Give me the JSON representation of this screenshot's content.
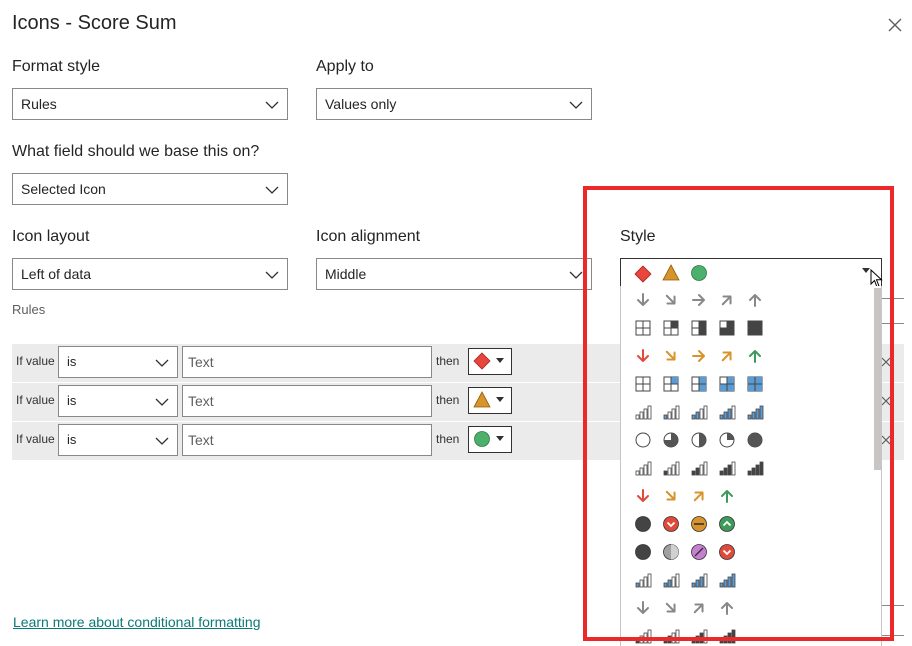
{
  "dialog": {
    "title": "Icons - Score Sum"
  },
  "format_style": {
    "label": "Format style",
    "value": "Rules"
  },
  "apply_to": {
    "label": "Apply to",
    "value": "Values only"
  },
  "base_field": {
    "label": "What field should we base this on?",
    "value": "Selected Icon"
  },
  "icon_layout": {
    "label": "Icon layout",
    "value": "Left of data"
  },
  "icon_alignment": {
    "label": "Icon alignment",
    "value": "Middle"
  },
  "style": {
    "label": "Style",
    "selected_icons": [
      "red-diamond-icon",
      "orange-triangle-icon",
      "green-circle-icon"
    ]
  },
  "rules": {
    "label": "Rules",
    "rows": [
      {
        "prefix": "If value",
        "operator": "is",
        "value": "Text",
        "then": "then",
        "icon": "red-diamond-icon"
      },
      {
        "prefix": "If value",
        "operator": "is",
        "value": "Text",
        "then": "then",
        "icon": "orange-triangle-icon"
      },
      {
        "prefix": "If value",
        "operator": "is",
        "value": "Text",
        "then": "then",
        "icon": "green-circle-icon"
      }
    ]
  },
  "style_options": [
    [
      "gray-arrow-down",
      "gray-arrow-down-right",
      "gray-arrow-right",
      "gray-arrow-up-right",
      "gray-arrow-up"
    ],
    [
      "quarters-0",
      "quarters-1",
      "quarters-2",
      "quarters-3",
      "quarters-4"
    ],
    [
      "red-arrow-down",
      "orange-arrow-down-right",
      "orange-arrow-right",
      "orange-arrow-up-right",
      "green-arrow-up"
    ],
    [
      "blue-quarters-0",
      "blue-quarters-1",
      "blue-quarters-2",
      "blue-quarters-3",
      "blue-quarters-4"
    ],
    [
      "blue-bars-0",
      "blue-bars-1",
      "blue-bars-2",
      "blue-bars-3",
      "blue-bars-4"
    ],
    [
      "pie-0",
      "pie-75",
      "pie-50",
      "pie-25",
      "pie-100"
    ],
    [
      "dark-bars-0",
      "dark-bars-1",
      "dark-bars-2",
      "dark-bars-3",
      "dark-bars-4"
    ],
    [
      "red-arrow-down",
      "orange-arrow-down-right",
      "orange-arrow-up-right",
      "green-arrow-up"
    ],
    [
      "black-circle",
      "red-circle-down",
      "orange-circle-minus",
      "green-circle-up"
    ],
    [
      "black-circle",
      "gray-circle-half",
      "purple-circle-slash",
      "red-circle-down"
    ],
    [
      "blue-bars-1",
      "blue-bars-2",
      "blue-bars-3",
      "blue-bars-4"
    ],
    [
      "gray-arrow-down",
      "gray-arrow-down-right",
      "gray-arrow-up-right",
      "gray-arrow-up"
    ],
    [
      "dark-bars-1",
      "dark-bars-2",
      "dark-bars-3",
      "dark-bars-4"
    ]
  ],
  "footer": {
    "learn_more": "Learn more about conditional formatting"
  },
  "colors": {
    "accent": "#0b7a75",
    "highlight": "#ec2828",
    "red": "#e8453c",
    "orange": "#d8932a",
    "green": "#4caf6b",
    "blue": "#5b9bd5"
  }
}
